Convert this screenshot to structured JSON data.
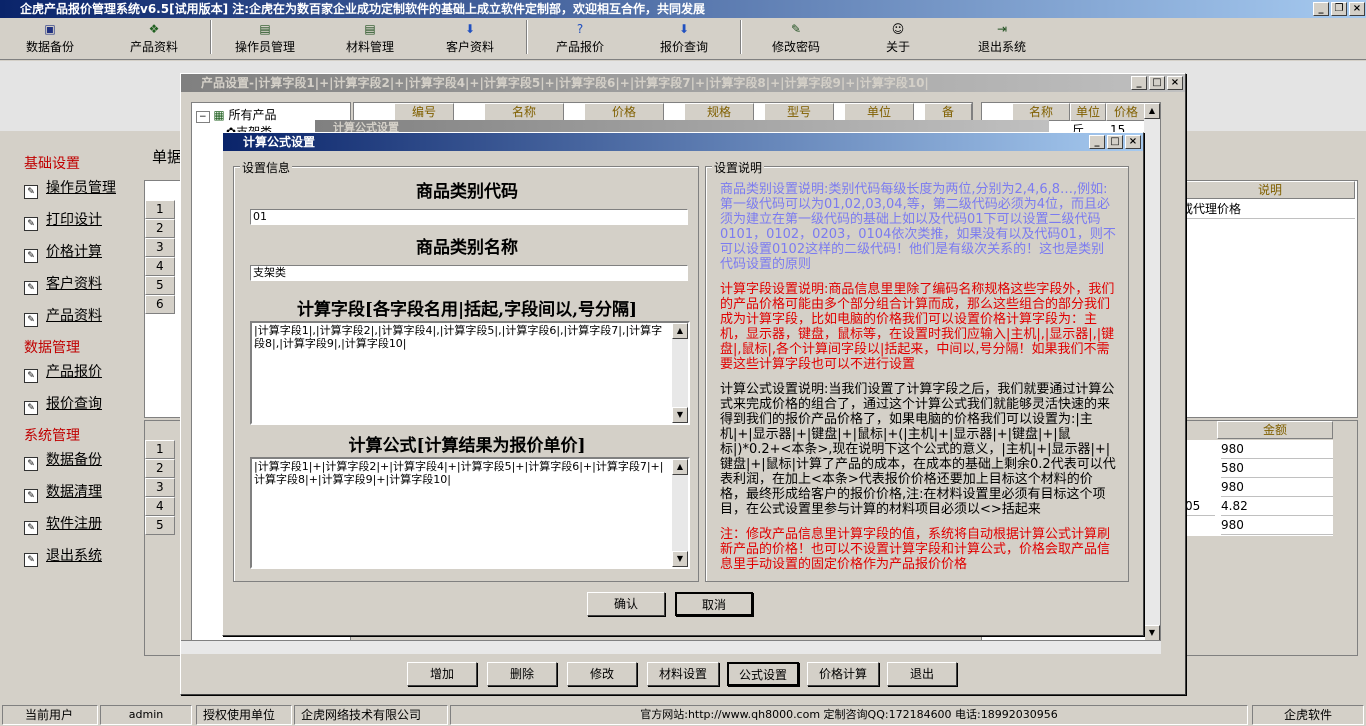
{
  "app": {
    "title": "企虎产品报价管理系统v6.5[试用版本] 注:企虎在为数百家企业成功定制软件的基础上成立软件定制部，欢迎相互合作，共同发展"
  },
  "toolbar": [
    {
      "label": "数据备份",
      "icon": "database-icon"
    },
    {
      "label": "产品资料",
      "icon": "tree-icon"
    },
    {
      "label": "操作员管理",
      "icon": "monitor-icon"
    },
    {
      "label": "材料管理",
      "icon": "monitor-icon"
    },
    {
      "label": "客户资料",
      "icon": "download-arrow-icon"
    },
    {
      "label": "产品报价",
      "icon": "help-icon"
    },
    {
      "label": "报价查询",
      "icon": "download-arrow-icon"
    },
    {
      "label": "修改密码",
      "icon": "pen-icon"
    },
    {
      "label": "关于",
      "icon": "person-icon"
    },
    {
      "label": "退出系统",
      "icon": "exit-icon"
    }
  ],
  "sidebar": {
    "sections": [
      {
        "title": "基础设置",
        "items": [
          "操作员管理",
          "打印设计",
          "价格计算",
          "客户资料",
          "产品资料"
        ]
      },
      {
        "title": "数据管理",
        "items": [
          "产品报价",
          "报价查询"
        ]
      },
      {
        "title": "系统管理",
        "items": [
          "数据备份",
          "数据清理",
          "软件注册",
          "退出系统"
        ]
      }
    ]
  },
  "background": {
    "label_left": "单据",
    "upper_rows": [
      "1",
      "2",
      "3",
      "4",
      "5",
      "6"
    ],
    "upper_col": "说明",
    "upper_cell": "或代理价格",
    "lower_rows": [
      "1",
      "2",
      "3",
      "4",
      "5"
    ],
    "lower_col": "金额",
    "lower_values": [
      "980",
      "580",
      "980",
      "4.82",
      "980"
    ],
    "lower_extra": "05"
  },
  "product_window": {
    "title": "产品设置-|计算字段1|+|计算字段2|+|计算字段4|+|计算字段5|+|计算字段6|+|计算字段7|+|计算字段8|+|计算字段9|+|计算字段10|",
    "tree_root": "所有产品",
    "tree_child": "支架类",
    "grid_headers": [
      "编号",
      "名称",
      "价格",
      "规格",
      "型号",
      "单位",
      "备"
    ],
    "right_headers": [
      "名称",
      "单位",
      "价格"
    ],
    "right_row": {
      "unit": "斤",
      "price": "15"
    },
    "behind_dialog_title": "计算公式设置",
    "buttons": [
      "增加",
      "删除",
      "修改",
      "材料设置",
      "公式设置",
      "价格计算",
      "退出"
    ]
  },
  "dialog": {
    "title": "计算公式设置",
    "left_group": "设置信息",
    "right_group": "设置说明",
    "code_heading": "商品类别代码",
    "code_value": "01",
    "name_heading": "商品类别名称",
    "name_value": "支架类",
    "fields_heading": "计算字段[各字段名用|括起,字段间以,号分隔]",
    "fields_value": "|计算字段1|,|计算字段2|,|计算字段4|,|计算字段5|,|计算字段6|,|计算字段7|,|计算字段8|,|计算字段9|,|计算字段10|",
    "formula_heading": "计算公式[计算结果为报价单价]",
    "formula_value": "|计算字段1|+|计算字段2|+|计算字段4|+|计算字段5|+|计算字段6|+|计算字段7|+|计算字段8|+|计算字段9|+|计算字段10|",
    "explain_blue": "商品类别设置说明:类别代码每级长度为两位,分别为2,4,6,8…,例如:第一级代码可以为01,02,03,04,等，第二级代码必须为4位，而且必须为建立在第一级代码的基础上如以及代码01下可以设置二级代码0101，0102，0203，0104依次类推，如果没有以及代码01，则不可以设置0102这样的二级代码！他们是有级次关系的！这也是类别代码设置的原则",
    "explain_red": "计算字段设置说明:商品信息里里除了编码名称规格这些字段外，我们的产品价格可能由多个部分组合计算而成，那么这些组合的部分我们成为计算字段，比如电脑的价格我们可以设置价格计算字段为：主机，显示器，键盘，鼠标等，在设置时我们应输入|主机|,|显示器|,|键盘|,鼠标|,各个计算间字段以|括起来，中间以,号分隔！如果我们不需要这些计算字段也可以不进行设置",
    "explain_black": "计算公式设置说明:当我们设置了计算字段之后，我们就要通过计算公式来完成价格的组合了，通过这个计算公式我们就能够灵活快速的来得到我们的报价产品价格了，如果电脑的价格我们可以设置为:|主机|+|显示器|+|键盘|+|鼠标|+(|主机|+|显示器|+|键盘|+|鼠标|)*0.2+<本条>,现在说明下这个公式的意义，|主机|+|显示器|+|键盘|+|鼠标|计算了产品的成本，在成本的基础上剩余0.2代表可以代表利润，在加上<本条>代表报价价格还要加上目标这个材料的价格，最终形成给客户的报价价格,注:在材料设置里必须有目标这个项目，在公式设置里参与计算的材料项目必须以<>括起来",
    "explain_note": "注：修改产品信息里计算字段的值，系统将自动根据计算公式计算刷新产品的价格！也可以不设置计算字段和计算公式，价格会取产品信息里手动设置的固定价格作为产品报价价格",
    "ok_label": "确认",
    "cancel_label": "取消"
  },
  "statusbar": {
    "user_label": "当前用户",
    "user_value": "admin",
    "auth_label": "授权使用单位",
    "auth_value": "企虎网络技术有限公司",
    "info": "官方网站:http://www.qh8000.com 定制咨询QQ:172184600 电话:18992030956",
    "brand": "企虎软件"
  },
  "colors": {
    "title_blue": "#0a246a",
    "section_red": "#c00000",
    "explain_blue": "#7b7bf0",
    "explain_red": "#e00000"
  }
}
